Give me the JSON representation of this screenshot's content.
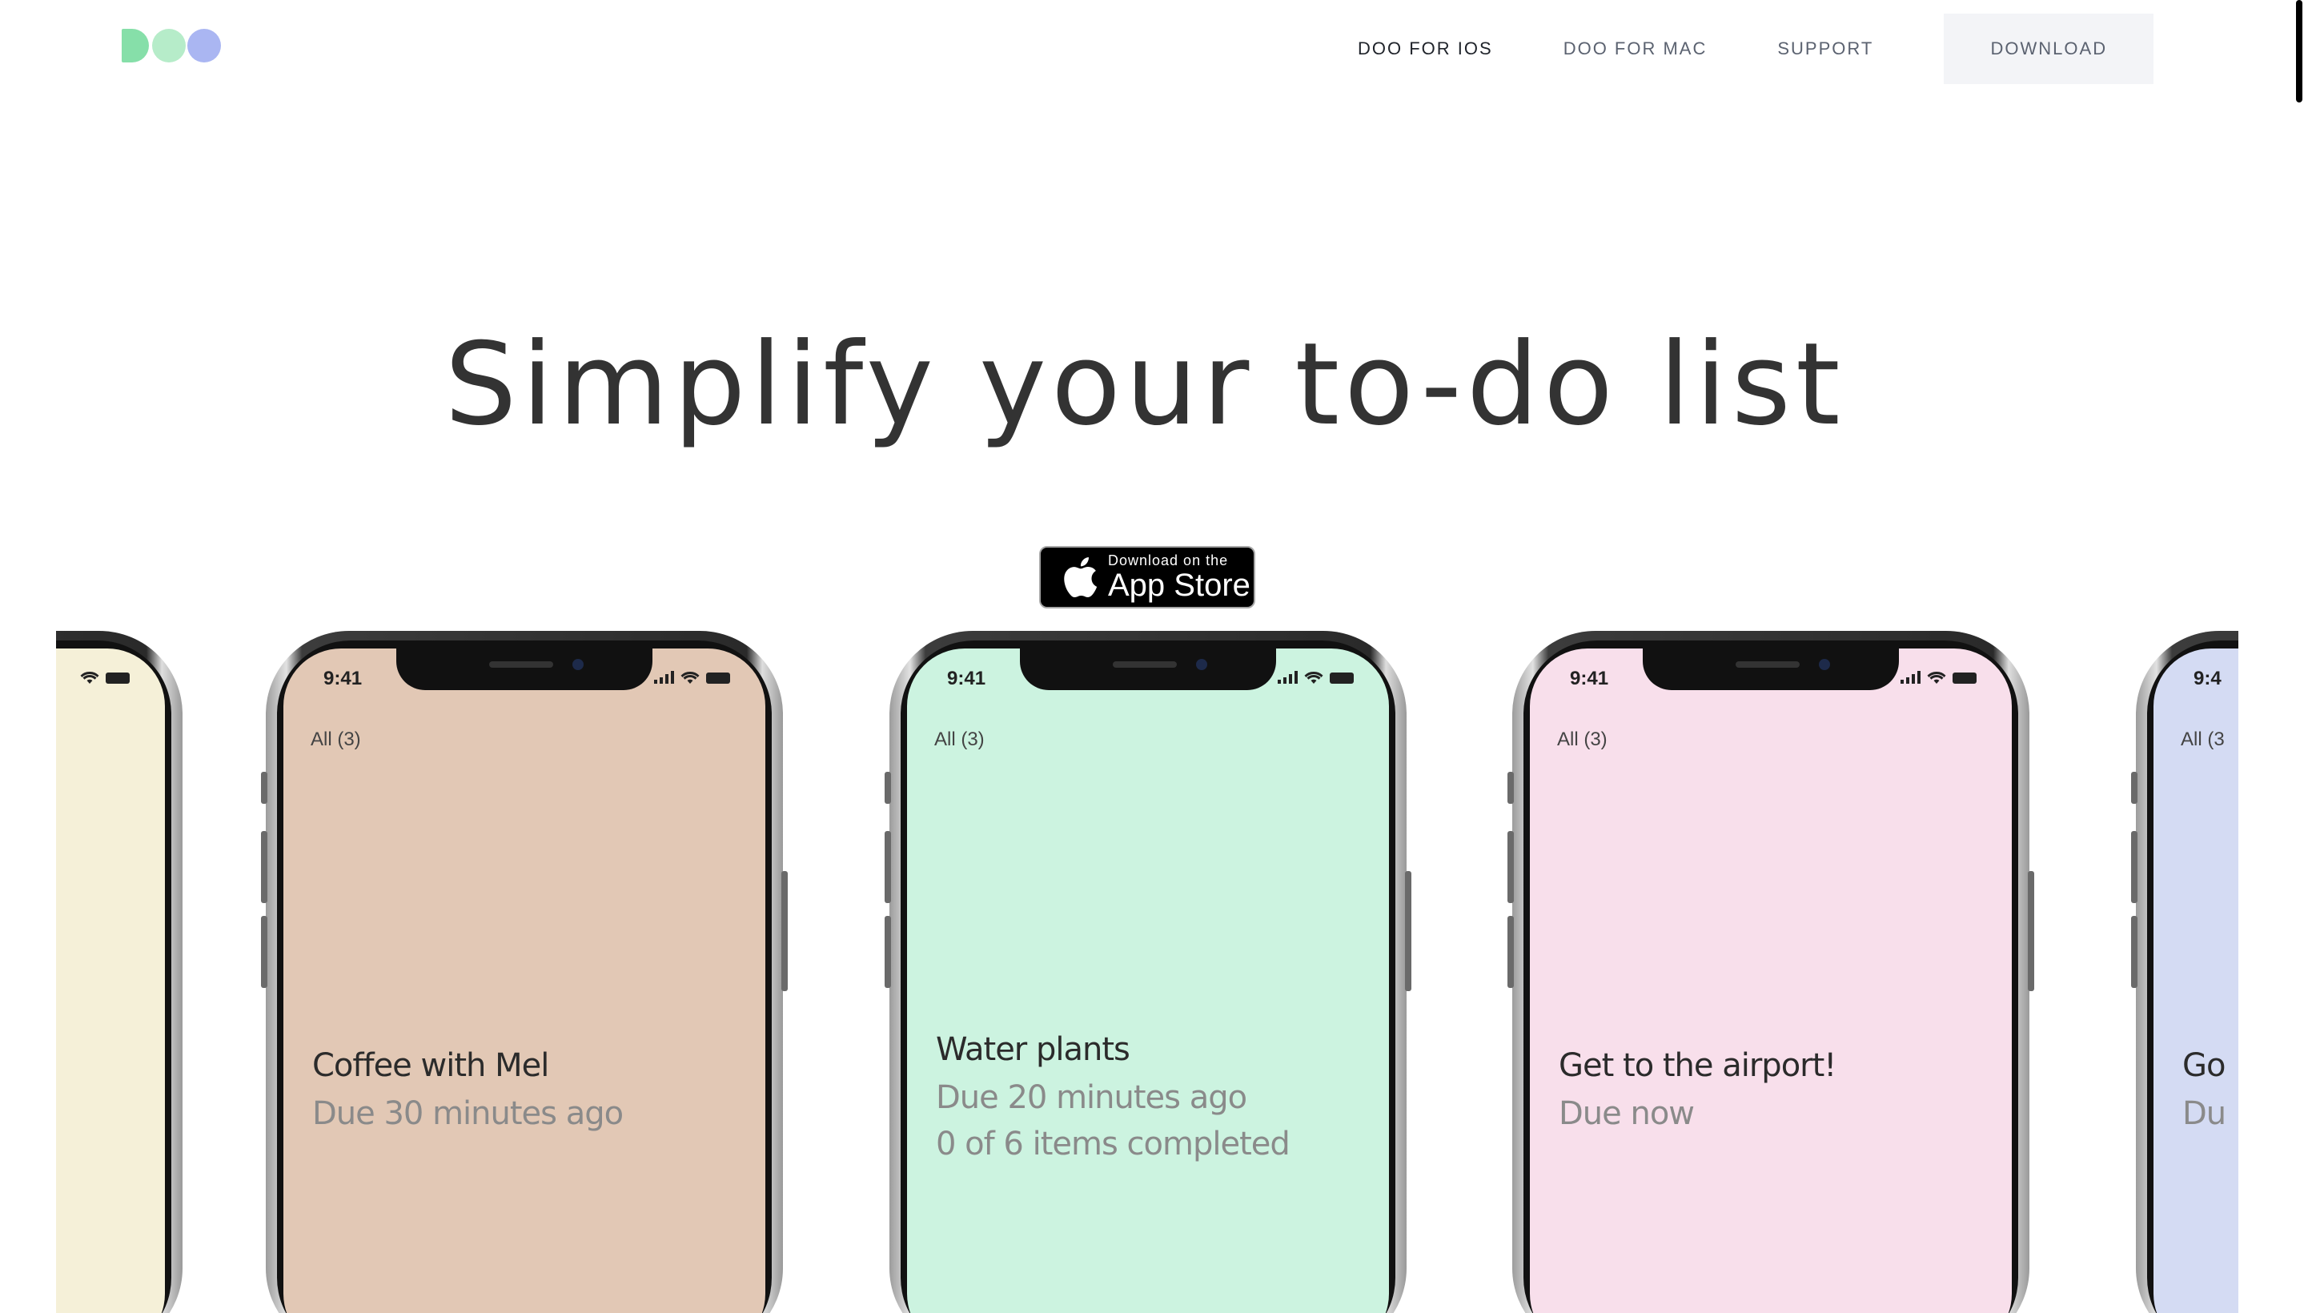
{
  "nav": {
    "items": [
      {
        "label": "DOO FOR IOS"
      },
      {
        "label": "DOO FOR MAC"
      },
      {
        "label": "SUPPORT"
      }
    ],
    "download_label": "DOWNLOAD"
  },
  "hero": {
    "headline": "Simplify your to-do list"
  },
  "app_store_badge": {
    "small_text": "Download on the",
    "big_text": "App Store"
  },
  "phones": [
    {
      "color": "#f5f0d8",
      "time": "",
      "filter": "",
      "title": "",
      "subtitle": "",
      "extra": ""
    },
    {
      "color": "#e2c8b5",
      "time": "9:41",
      "filter": "All (3)",
      "title": "Coffee with Mel",
      "subtitle": "Due 30 minutes ago",
      "extra": ""
    },
    {
      "color": "#ccf3e0",
      "time": "9:41",
      "filter": "All (3)",
      "title": "Water plants",
      "subtitle": "Due 20 minutes ago",
      "extra": "0 of 6 items completed"
    },
    {
      "color": "#f8dfeb",
      "time": "9:41",
      "filter": "All (3)",
      "title": "Get to the airport!",
      "subtitle": "Due now",
      "extra": ""
    },
    {
      "color": "#d4dbf3",
      "time": "9:4",
      "filter": "All (3",
      "title": "Go",
      "subtitle": "Du",
      "extra": ""
    }
  ],
  "colors": {
    "logo_d": "#86dfa9",
    "logo_o1": "#b6ecc9",
    "logo_o2": "#aab6f2",
    "download_bg": "#f3f4f7"
  }
}
